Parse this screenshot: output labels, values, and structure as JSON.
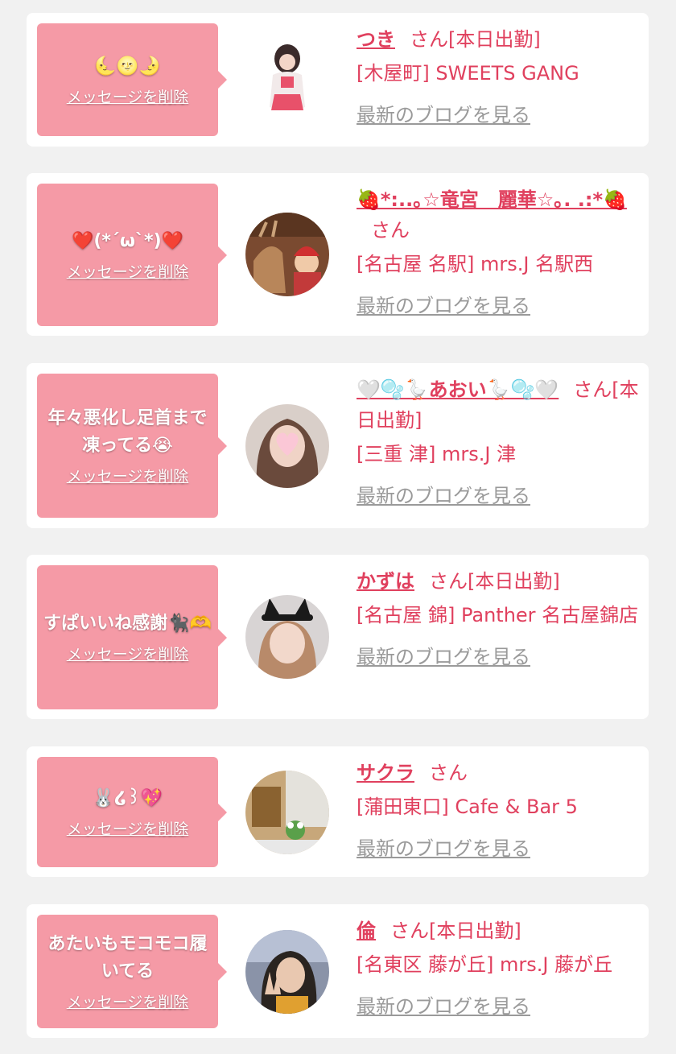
{
  "colors": {
    "accent": "#e0405e",
    "bubble": "#f59aa6",
    "link_gray": "#9a9a9a"
  },
  "common": {
    "delete_label": "メッセージを削除",
    "san_label": "さん",
    "blog_label": "最新のブログを見る"
  },
  "items": [
    {
      "message": "🌜🌝🌛",
      "name": "つき",
      "status": "[本日出勤]",
      "shop": "[木屋町] SWEETS GANG"
    },
    {
      "message": "❤️(*´ω`*)❤️",
      "name": "🍓*:..｡☆竜宮　麗華☆｡. .:*🍓",
      "status": "",
      "shop": "[名古屋 名駅] mrs.J 名駅西"
    },
    {
      "message": "年々悪化し足首まで凍ってる😭",
      "name": "🤍🫧🪿あおい🪿🫧🤍",
      "status": "[本日出勤]",
      "shop": "[三重 津] mrs.J 津"
    },
    {
      "message": "すぱいいね感謝🐈‍⬛🫶",
      "name": "かずは",
      "status": "[本日出勤]",
      "shop": "[名古屋 錦] Panther 名古屋錦店"
    },
    {
      "message": "🐰໒꒱💖",
      "name": "サクラ",
      "status": "",
      "shop": "[蒲田東口] Cafe & Bar 5"
    },
    {
      "message": "あたいもモコモコ履いてる",
      "name": "倫",
      "status": "[本日出勤]",
      "shop": "[名東区 藤が丘] mrs.J 藤が丘"
    }
  ]
}
